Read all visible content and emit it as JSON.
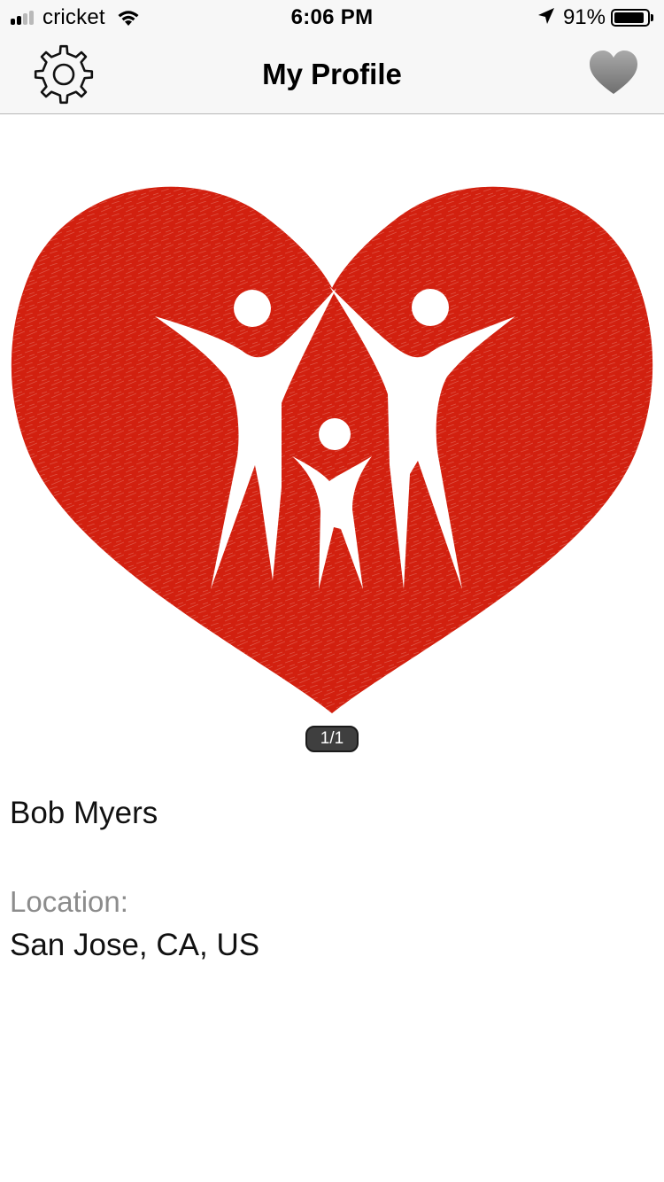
{
  "status_bar": {
    "carrier": "cricket",
    "time": "6:06 PM",
    "battery_percent": "91%",
    "battery_level": 0.91,
    "signal_bars_total": 4,
    "signal_bars_filled": 2
  },
  "nav": {
    "title": "My Profile",
    "left_icon": "gear-icon",
    "right_icon": "heart-icon"
  },
  "profile": {
    "photo_icon": "family-heart-logo",
    "photo_pager": "1/1",
    "name": "Bob Myers",
    "location_label": "Location:",
    "location_value": "San Jose, CA, US"
  },
  "colors": {
    "heart_red": "#d2200f",
    "nav_background": "#f7f7f7",
    "label_gray": "#8c8c8c",
    "favorite_gray": "#8e8e8e"
  }
}
